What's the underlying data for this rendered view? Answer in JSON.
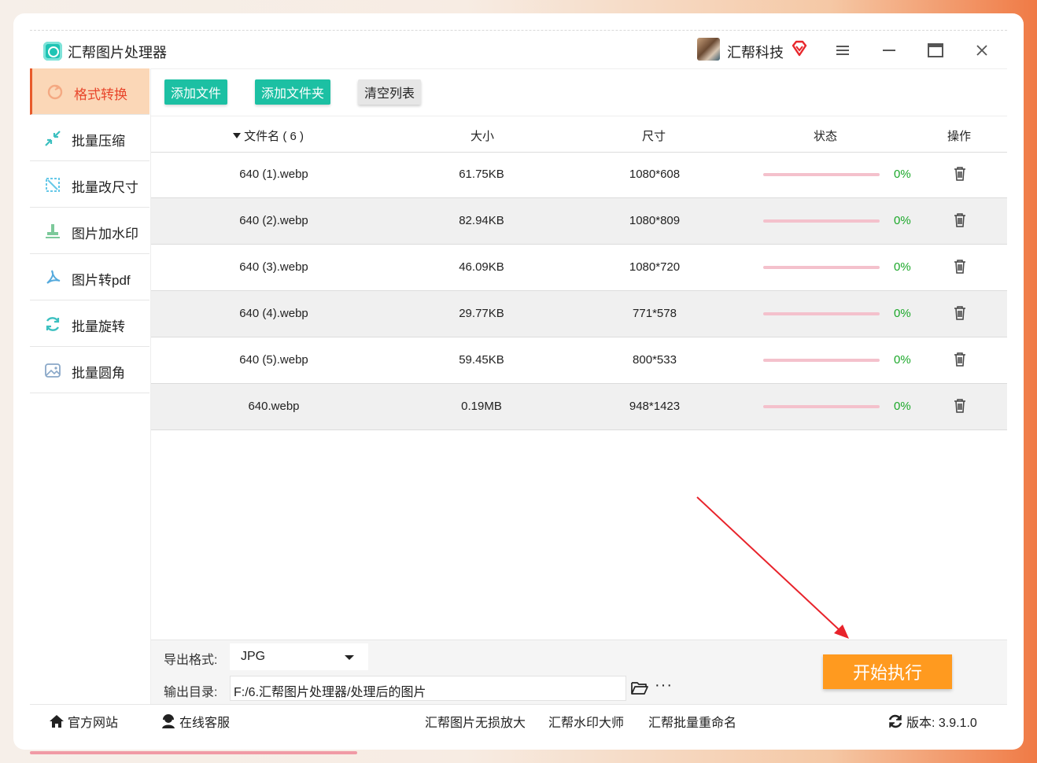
{
  "app": {
    "title": "汇帮图片处理器",
    "user_name": "汇帮科技"
  },
  "colors": {
    "accent_orange": "#ff9a1f",
    "active_red": "#e8462b",
    "green": "#1cc0a3",
    "progress_bg": "#f4c1cc",
    "percent_green": "#1ca82a"
  },
  "sidebar": {
    "items": [
      {
        "label": "格式转换",
        "icon": "convert-icon",
        "active": true
      },
      {
        "label": "批量压缩",
        "icon": "compress-icon",
        "active": false
      },
      {
        "label": "批量改尺寸",
        "icon": "resize-icon",
        "active": false
      },
      {
        "label": "图片加水印",
        "icon": "stamp-icon",
        "active": false
      },
      {
        "label": "图片转pdf",
        "icon": "pdf-icon",
        "active": false
      },
      {
        "label": "批量旋转",
        "icon": "rotate-icon",
        "active": false
      },
      {
        "label": "批量圆角",
        "icon": "image-corner-icon",
        "active": false
      }
    ]
  },
  "toolbar": {
    "add_file": "添加文件",
    "add_folder": "添加文件夹",
    "clear_list": "清空列表"
  },
  "table": {
    "headers": {
      "name": "文件名 ( 6 )",
      "size": "大小",
      "dimensions": "尺寸",
      "status": "状态",
      "actions": "操作"
    },
    "rows": [
      {
        "name": "640 (1).webp",
        "size": "61.75KB",
        "dimensions": "1080*608",
        "progress": "0%"
      },
      {
        "name": "640 (2).webp",
        "size": "82.94KB",
        "dimensions": "1080*809",
        "progress": "0%"
      },
      {
        "name": "640 (3).webp",
        "size": "46.09KB",
        "dimensions": "1080*720",
        "progress": "0%"
      },
      {
        "name": "640 (4).webp",
        "size": "29.77KB",
        "dimensions": "771*578",
        "progress": "0%"
      },
      {
        "name": "640 (5).webp",
        "size": "59.45KB",
        "dimensions": "800*533",
        "progress": "0%"
      },
      {
        "name": "640.webp",
        "size": "0.19MB",
        "dimensions": "948*1423",
        "progress": "0%"
      }
    ]
  },
  "export": {
    "format_label": "导出格式:",
    "format_value": "JPG",
    "dir_label": "输出目录:",
    "dir_value": "F:/6.汇帮图片处理器/处理后的图片",
    "more": "···",
    "start": "开始执行"
  },
  "footer": {
    "website": "官方网站",
    "support": "在线客服",
    "link1": "汇帮图片无损放大",
    "link2": "汇帮水印大师",
    "link3": "汇帮批量重命名",
    "version": "版本: 3.9.1.0"
  }
}
